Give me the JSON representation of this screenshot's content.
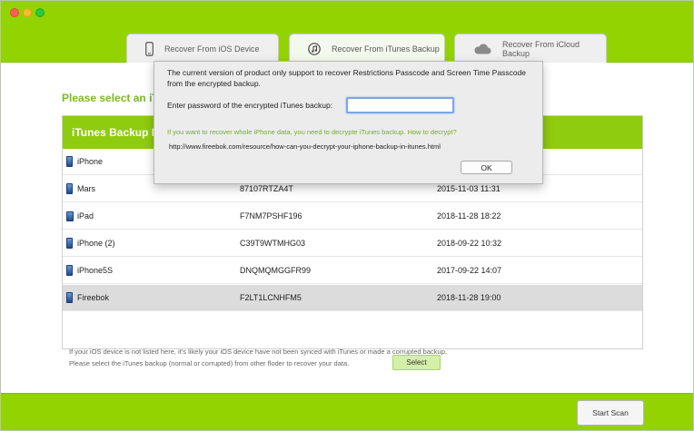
{
  "tabs": [
    {
      "label": "Recover From iOS Device",
      "icon": "phone-icon"
    },
    {
      "label": "Recover From iTunes Backup",
      "icon": "music-note-icon"
    },
    {
      "label": "Recover From iCloud Backup",
      "icon": "cloud-icon"
    }
  ],
  "main": {
    "heading": "Please select an iTunes backup to recover:",
    "table_title": "iTunes Backup Name",
    "rows": [
      {
        "name": "iPhone",
        "serial": "",
        "date": "",
        "icon": "iphone-icon",
        "selected": false
      },
      {
        "name": "Mars",
        "serial": "87107RTZA4T",
        "date": "2015-11-03 11:31",
        "icon": "iphone-icon",
        "selected": false
      },
      {
        "name": "iPad",
        "serial": "F7NM7PSHF196",
        "date": "2018-11-28 18:22",
        "icon": "ipad-icon",
        "selected": false
      },
      {
        "name": "iPhone (2)",
        "serial": "C39T9WTMHG03",
        "date": "2018-09-22 10:32",
        "icon": "iphone-icon",
        "selected": false
      },
      {
        "name": "iPhone5S",
        "serial": "DNQMQMGGFR99",
        "date": "2017-09-22 14:07",
        "icon": "iphone-icon",
        "selected": false
      },
      {
        "name": "Fireebok",
        "serial": "F2LT1LCNHFM5",
        "date": "2018-11-28 19:00",
        "icon": "iphone-icon",
        "selected": true
      }
    ],
    "note_line1": "If your iOS device is not listed here, it's likely your iOS device have not been synced with iTunes or made a corrupted backup.",
    "note_line2": "Please select the iTunes backup (normal or corrupted) from other floder to recover your data.",
    "select_button": "Select"
  },
  "footer": {
    "start_scan": "Start Scan"
  },
  "dialog": {
    "message": "The current version of product only support to recover Restrictions Passcode and Screen Time Passcode from the encrypted backup.",
    "password_label": "Enter password of the encrypted iTunes backup:",
    "password_value": "",
    "hint": "If you want to recover whole iPhone data, you need to decrypte iTunes backup. How to decrypt?",
    "url": "http://www.fireebok.com/resource/how-can-you-decrypt-your-iphone-backup-in-itunes.html",
    "ok_button": "OK"
  },
  "colors": {
    "brand_green": "#93d400",
    "header_green": "#8fcb0f",
    "hint_green": "#76b11b"
  }
}
